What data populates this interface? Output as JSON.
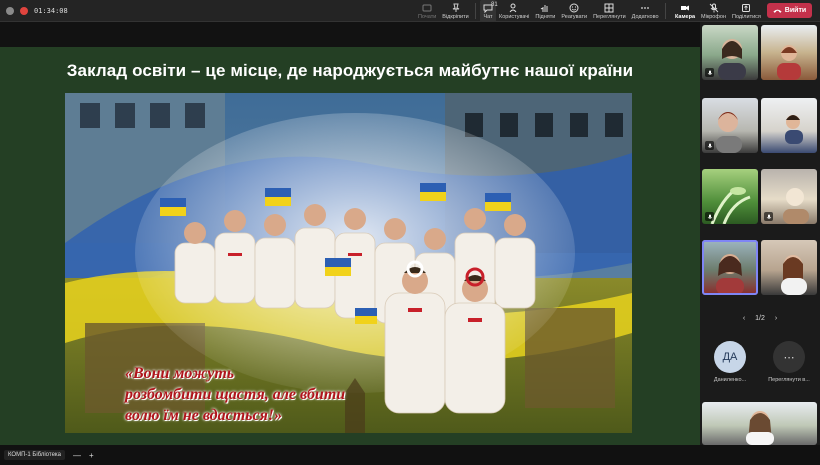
{
  "timer": "01:34:08",
  "colors": {
    "leave": "#c4314b",
    "slide_bg": "#243f24",
    "accent": "#7f85f5",
    "quote": "#b0141b"
  },
  "toolbar": {
    "left_items": [
      {
        "label": "Почати",
        "icon": "share-icon",
        "dim": true
      },
      {
        "label": "Відкріпити",
        "icon": "unpin-icon",
        "dim": false
      }
    ],
    "right_items": [
      {
        "label": "Чат",
        "icon": "chat-icon"
      },
      {
        "label": "Користувачі",
        "icon": "people-icon",
        "count": "81"
      },
      {
        "label": "Підняти",
        "icon": "raise-hand-icon"
      },
      {
        "label": "Реагувати",
        "icon": "react-icon"
      },
      {
        "label": "Переглянути",
        "icon": "view-icon"
      },
      {
        "label": "Додатково",
        "icon": "more-icon"
      }
    ],
    "device_items": [
      {
        "label": "Камера",
        "icon": "camera-icon"
      },
      {
        "label": "Мікрофон",
        "icon": "mic-off-icon"
      },
      {
        "label": "Поділитися",
        "icon": "share-screen-icon"
      }
    ],
    "leave_label": "Вийти"
  },
  "slide": {
    "title": "Заклад освіти – це місце, де народжується майбутнє нашої країни",
    "quote": "«Вони  можуть\nрозбомбити щастя, але вбити\nволю їм не вдасться!»"
  },
  "gallery": {
    "pager": "1/2",
    "avatars": [
      {
        "initials": "ДА",
        "name": "Даниленко..."
      },
      {
        "initials": "⋯",
        "name": "Переглянути в..."
      }
    ]
  },
  "bottom": {
    "meeting_name": "КОМП-1 Бібліотека",
    "zoom_out": "—",
    "zoom_in": "+"
  }
}
